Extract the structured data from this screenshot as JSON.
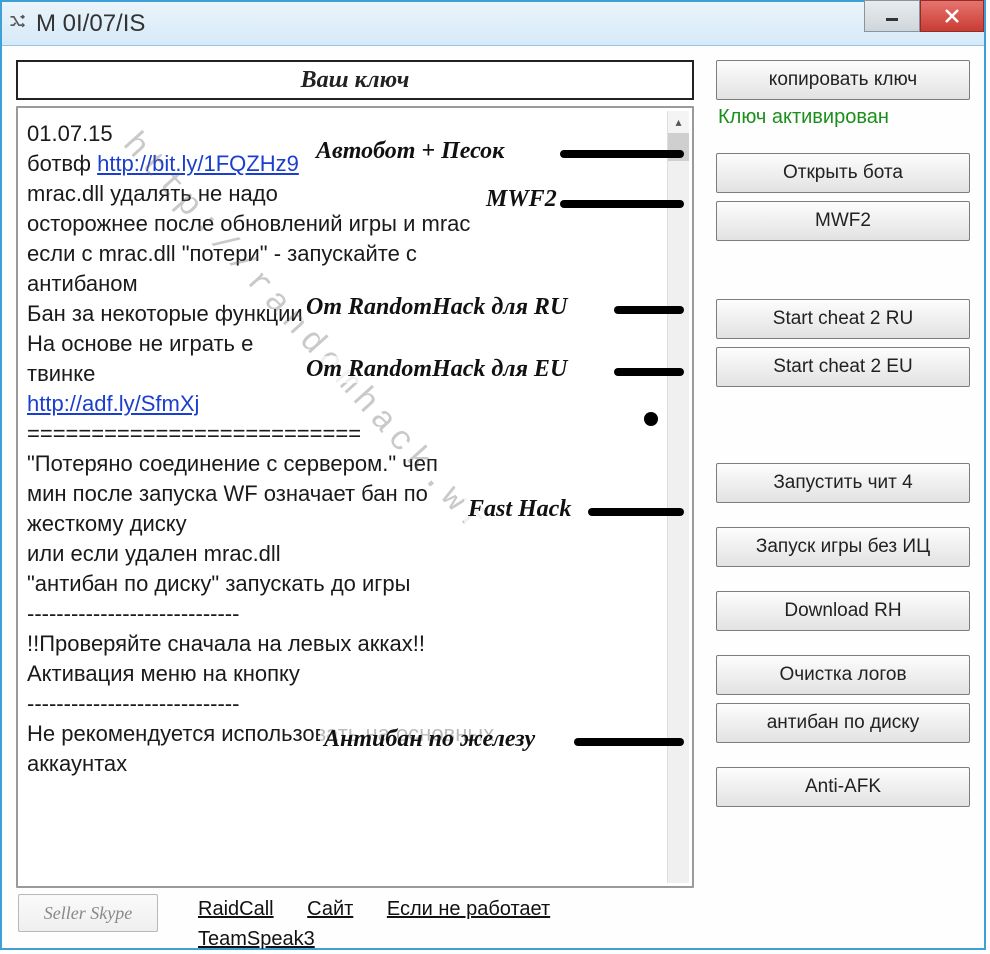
{
  "window": {
    "title": "M 0I/07/IS"
  },
  "key_input_placeholder": "Ваш ключ",
  "copy_key_label": "копировать ключ",
  "status_text": "Ключ активирован",
  "buttons": {
    "open_bot": "Открыть бота",
    "mwf2": "MWF2",
    "cheat2_ru": "Start cheat 2 RU",
    "cheat2_eu": "Start cheat 2 EU",
    "cheat4": "Запустить чит 4",
    "no_ic": "Запуск игры без ИЦ",
    "download_rh": "Download RH",
    "clean_logs": "Очистка логов",
    "antiban_disk": "антибан по диску",
    "anti_afk": "Anti-AFK",
    "seller": "Seller Skype"
  },
  "links": {
    "raidcall": "RaidCall",
    "site": "Сайт",
    "not_working": "Если не работает",
    "teamspeak": "TeamSpeak3"
  },
  "annotations": {
    "autobot": "Автобот + Песок",
    "mwf2": "MWF2",
    "rh_ru": "От RandomHack для RU",
    "rh_eu": "От RandomHack для EU",
    "fast_hack": "Fast Hack",
    "antiban_hw": "Антибан по железу"
  },
  "watermark": "http://randomhack.wf",
  "news": {
    "date": "01.07.15",
    "line2a": "ботвф ",
    "link1": "http://bit.ly/1FQZHz9",
    "line3": "mrac.dll удалять не надо",
    "line4": "осторожнее после обновлений игры и mrac",
    "line5": "если с mrac.dll \"потери\" - запускайте с",
    "line6": "антибаном",
    "line7": "Бан за некоторые функции",
    "line8": "На основе не играть е",
    "line9": "твинке",
    "link2": "http://adf.ly/SfmXj",
    "divider": "==========================",
    "line11": "\"Потеряно соединение с сервером.\" чеп",
    "line12": "мин после запуска WF означает бан по",
    "line13": "жесткому диску",
    "line14": "или если удален mrac.dll",
    "line15": "\"антибан по диску\" запускать до игры",
    "dashes": "-----------------------------",
    "line17": "!!Проверяйте сначала на левых акках!!",
    "line18": "Активация меню на кнопку",
    "line20": "Не рекомендуется использовать на основных",
    "line21": "аккаунтах"
  }
}
